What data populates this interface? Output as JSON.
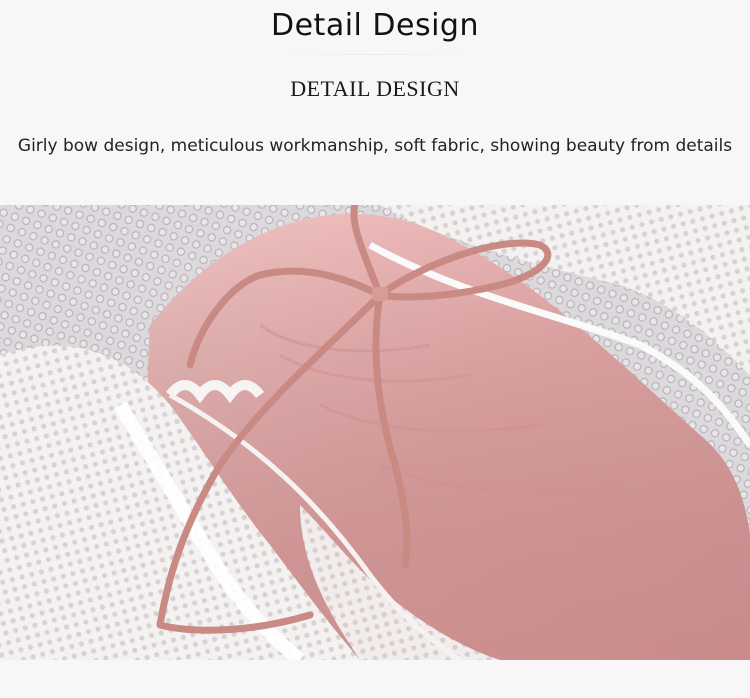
{
  "header": {
    "title": "Detail Design",
    "subtitle": "DETAIL DESIGN",
    "description": "Girly bow design, meticulous workmanship, soft fabric, showing beauty from details"
  },
  "photo": {
    "subject": "pink-lace-ruffle-panty-bow-detail"
  },
  "colors": {
    "background": "#f7f7f7",
    "fabric_pink": "#e9b2b2",
    "ribbon": "#c88c84",
    "lace_white": "#f3efee"
  }
}
